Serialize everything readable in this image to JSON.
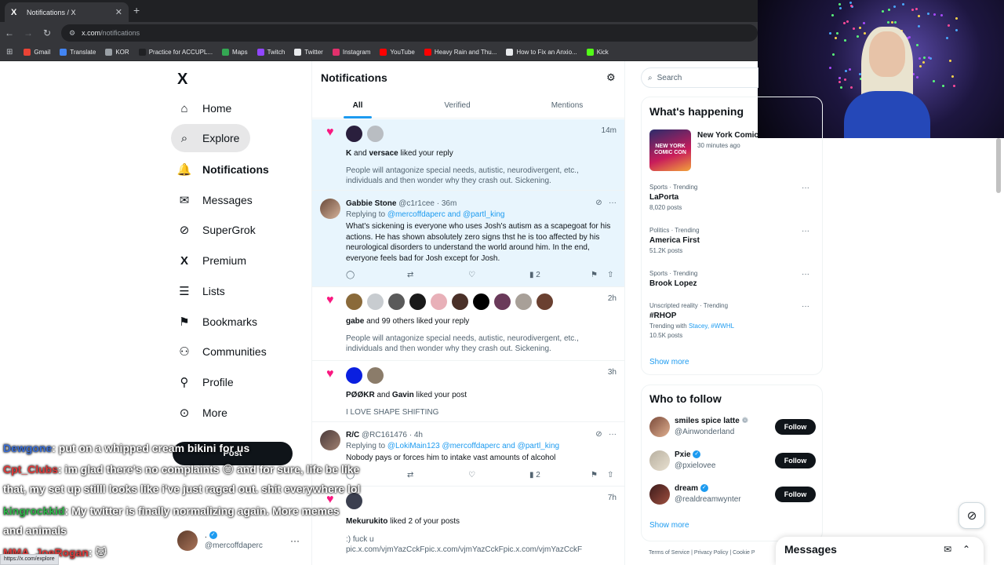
{
  "browser": {
    "tab_title": "Notifications / X",
    "tab_favicon": "X",
    "url_host": "x.com",
    "url_path": "/notifications",
    "bookmarks": [
      {
        "label": "Gmail",
        "color": "#ea4335"
      },
      {
        "label": "Translate",
        "color": "#4285f4"
      },
      {
        "label": "KOR",
        "color": "#9aa0a6"
      },
      {
        "label": "Practice for ACCUPL...",
        "color": "#202124"
      },
      {
        "label": "Maps",
        "color": "#34a853"
      },
      {
        "label": "Twitch",
        "color": "#9146ff"
      },
      {
        "label": "Twitter",
        "color": "#e8eaed"
      },
      {
        "label": "Instagram",
        "color": "#e1306c"
      },
      {
        "label": "YouTube",
        "color": "#ff0000"
      },
      {
        "label": "Heavy Rain and Thu...",
        "color": "#ff0000"
      },
      {
        "label": "How to Fix an Anxio...",
        "color": "#e8eaed"
      },
      {
        "label": "Kick",
        "color": "#53fc18"
      }
    ],
    "status_url": "https://x.com/explore"
  },
  "sidebar": {
    "logo": "X",
    "items": [
      {
        "label": "Home",
        "icon": "home-icon",
        "glyph": "⌂"
      },
      {
        "label": "Explore",
        "icon": "search-icon",
        "glyph": "⌕"
      },
      {
        "label": "Notifications",
        "icon": "bell-icon",
        "glyph": "🔔"
      },
      {
        "label": "Messages",
        "icon": "mail-icon",
        "glyph": "✉"
      },
      {
        "label": "SuperGrok",
        "icon": "grok-icon",
        "glyph": "⊘"
      },
      {
        "label": "Premium",
        "icon": "x-icon",
        "glyph": "X"
      },
      {
        "label": "Lists",
        "icon": "list-icon",
        "glyph": "☰"
      },
      {
        "label": "Bookmarks",
        "icon": "bookmark-icon",
        "glyph": "⚑"
      },
      {
        "label": "Communities",
        "icon": "people-icon",
        "glyph": "⚇"
      },
      {
        "label": "Profile",
        "icon": "person-icon",
        "glyph": "⚲"
      },
      {
        "label": "More",
        "icon": "more-circle-icon",
        "glyph": "⊙"
      }
    ],
    "post_label": "Post",
    "account": {
      "name": ".",
      "handle": "@mercoffdaperc"
    }
  },
  "chat": [
    {
      "name": "Dewgone",
      "color": "#3b6fd6",
      "text": ": put on a whipped cream bikini for us"
    },
    {
      "name": "Cpt_Clubs",
      "color": "#e03a3a",
      "text": ": im glad there's no complaints 😊 and for sure, life be like"
    },
    {
      "name": "",
      "color": "#ffffff",
      "text": "that, my set up stilll looks like i've just raged out. shit everywhere lol"
    },
    {
      "name": "kingrockkid",
      "color": "#2fb84a",
      "text": ": My twitter is finally normalizing again. More memes"
    },
    {
      "name": "",
      "color": "#ffffff",
      "text": "and animals"
    },
    {
      "name": "MMA_JoeRogan",
      "color": "#e03a3a",
      "text": ": 🐱"
    }
  ],
  "main": {
    "title": "Notifications",
    "tabs": [
      "All",
      "Verified",
      "Mentions"
    ],
    "notifications": [
      {
        "time": "14m",
        "actors": "K",
        "actors2": "versace",
        "and": "and",
        "action": "liked your reply",
        "quote": "People will antagonize special needs, autistic, neurodivergent, etc., individuals and then wonder why they crash out. Sickening."
      },
      {
        "name": "Gabbie Stone",
        "handle": "@c1r1cee · 36m",
        "replying_prefix": "Replying to",
        "replying_to": "@mercoffdaperc and @partl_king",
        "body": "What's sickening is everyone who uses Josh's autism as a scapegoat for his actions. He has shown absolutely zero signs thst he is too affected by his neurological disorders to understand the world around him. In the end, everyone feels bad for Josh except for Josh.",
        "views": "2"
      },
      {
        "time": "2h",
        "actors": "gabe",
        "action": "and 99 others liked your reply",
        "quote": "People will antagonize special needs, autistic, neurodivergent, etc., individuals and then wonder why they crash out. Sickening."
      },
      {
        "time": "3h",
        "actors": "PØØKR",
        "and": "and",
        "actors2": "Gavin",
        "action": "liked your post",
        "quote": "I LOVE SHAPE SHIFTING"
      },
      {
        "name": "R/C",
        "handle": "@RC161476 · 4h",
        "replying_prefix": "Replying to",
        "replying_to": "@LokiMain123 @mercoffdaperc and @partl_king",
        "body": "Nobody pays or forces him to intake vast amounts of alcohol",
        "views": "2"
      },
      {
        "time": "7h",
        "actors": "Mekurukito",
        "action": "liked 2 of your posts",
        "quote": ":) fuck u",
        "quote2": "pic.x.com/vjmYazCckFpic.x.com/vjmYazCckFpic.x.com/vjmYazCckF"
      }
    ]
  },
  "right": {
    "search_placeholder": "Search",
    "whats_happening": "What's happening",
    "news": {
      "title": "New York Comic",
      "time": "30 minutes ago",
      "thumb_text": "NEW YORK COMIC CON"
    },
    "trends": [
      {
        "category": "Sports · Trending",
        "name": "LaPorta",
        "count": "8,020 posts"
      },
      {
        "category": "Politics · Trending",
        "name": "America First",
        "count": "51.2K posts"
      },
      {
        "category": "Sports · Trending",
        "name": "Brook Lopez",
        "count": ""
      },
      {
        "category": "Unscripted reality · Trending",
        "name": "#RHOP",
        "with_prefix": "Trending with",
        "with_links": "Stacey, #WWHL",
        "count": "10.5K posts"
      }
    ],
    "show_more": "Show more",
    "who_to_follow": "Who to follow",
    "follow_suggestions": [
      {
        "name": "smiles spice latte",
        "handle": "@Ainwonderland",
        "badge": "❁"
      },
      {
        "name": "Pxie",
        "handle": "@pxielovee",
        "badge": "✓"
      },
      {
        "name": "dream",
        "handle": "@realdreamwynter",
        "badge": "✓"
      }
    ],
    "follow_label": "Follow",
    "show_more_2": "Show more",
    "footer": "Terms of Service  |  Privacy Policy  |  Cookie P",
    "messages_dock": "Messages"
  }
}
